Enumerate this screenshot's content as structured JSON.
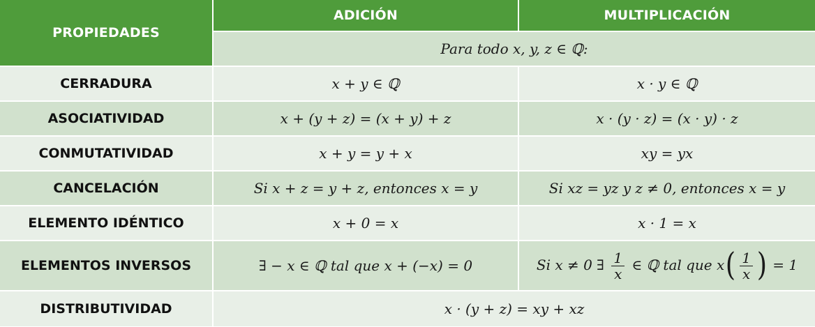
{
  "header": {
    "properties": "PROPIEDADES",
    "addition": "ADICIÓN",
    "multiplication": "MULTIPLICACIÓN",
    "for_all": "Para todo  x, y, z  ∈ ℚ:"
  },
  "rows": [
    {
      "property": "CERRADURA",
      "addition": "x + y  ∈ ℚ",
      "multiplication": "x · y  ∈ ℚ"
    },
    {
      "property": "ASOCIATIVIDAD",
      "addition": "x + (y + z) = (x + y) + z",
      "multiplication": "x · (y · z) = (x · y) · z"
    },
    {
      "property": "CONMUTATIVIDAD",
      "addition": "x + y = y + x",
      "multiplication": "xy = yx"
    },
    {
      "property": "CANCELACIÓN",
      "addition": "Si  x + z = y + z,  entonces  x = y",
      "multiplication": "Si  xz = yz  y  z ≠ 0,  entonces  x = y"
    },
    {
      "property": "ELEMENTO IDÉNTICO",
      "addition": "x + 0 = x",
      "multiplication": "x · 1 = x"
    },
    {
      "property": "ELEMENTOS INVERSOS",
      "addition": "∃ − x  ∈ ℚ  tal que  x + (−x) = 0",
      "multiplication": {
        "prefix": "Si x ≠ 0 ∃",
        "frac_num": "1",
        "frac_den": "x",
        "middle": "∈ ℚ  tal que  x",
        "paren_open": "(",
        "paren_num": "1",
        "paren_den": "x",
        "paren_close": ")",
        "suffix": "= 1"
      }
    },
    {
      "property": "DISTRIBUTIVIDAD",
      "both": "x · (y + z) = xy + xz"
    }
  ]
}
